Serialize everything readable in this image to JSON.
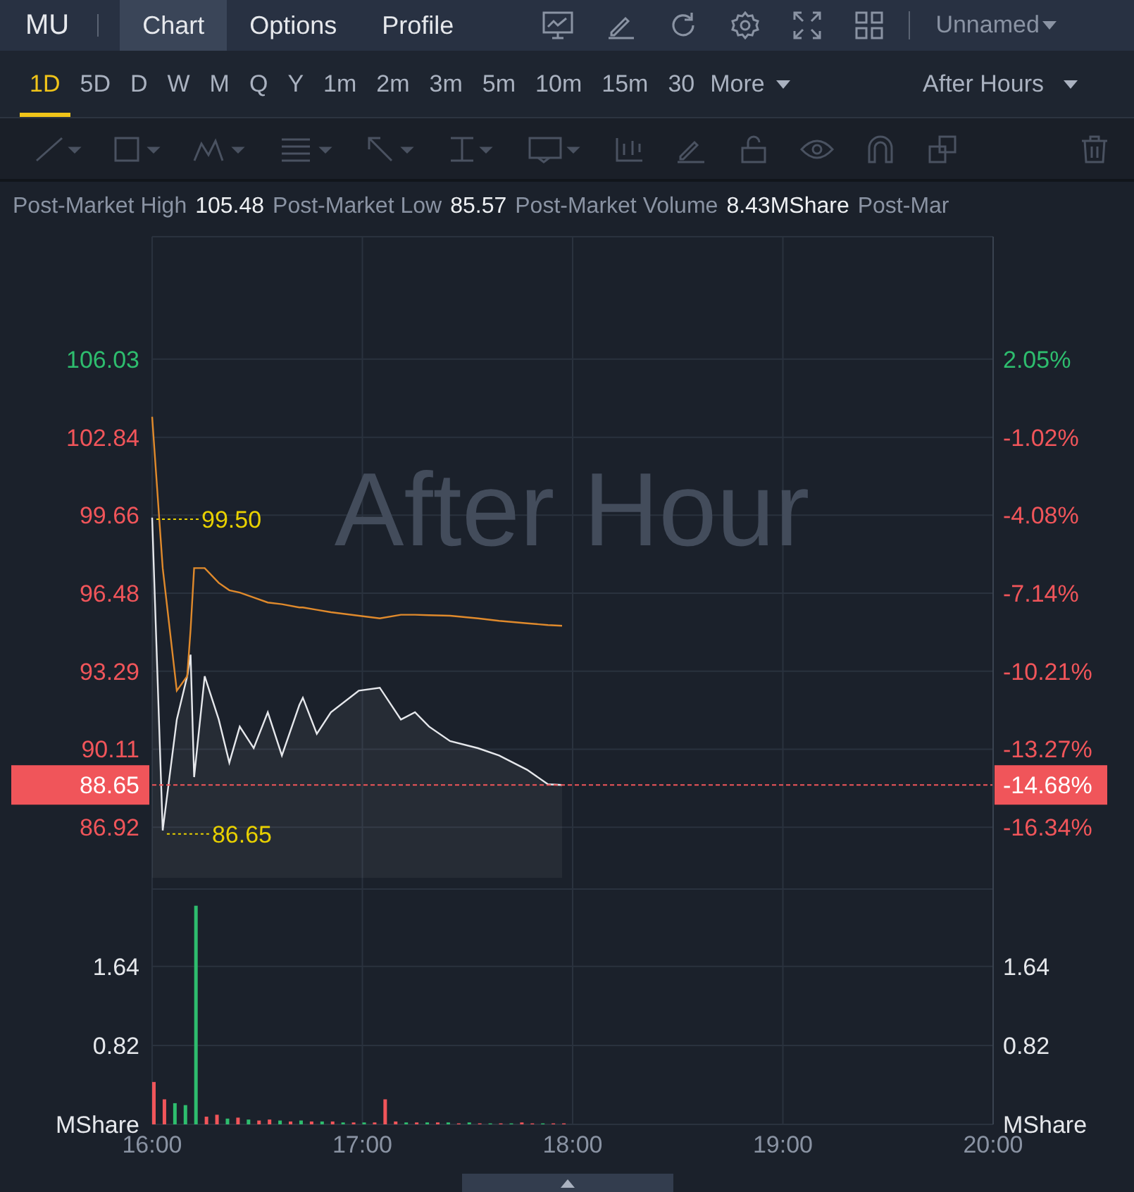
{
  "header": {
    "symbol": "MU",
    "tabs": [
      {
        "label": "Chart",
        "selected": true
      },
      {
        "label": "Options",
        "selected": false
      },
      {
        "label": "Profile",
        "selected": false
      }
    ],
    "layout_menu": "Unnamed"
  },
  "periods": [
    {
      "label": "1D",
      "selected": true
    },
    {
      "label": "5D",
      "selected": false
    },
    {
      "label": "D",
      "selected": false
    },
    {
      "label": "W",
      "selected": false
    },
    {
      "label": "M",
      "selected": false
    },
    {
      "label": "Q",
      "selected": false
    },
    {
      "label": "Y",
      "selected": false
    },
    {
      "label": "1m",
      "selected": false
    },
    {
      "label": "2m",
      "selected": false
    },
    {
      "label": "3m",
      "selected": false
    },
    {
      "label": "5m",
      "selected": false
    },
    {
      "label": "10m",
      "selected": false
    },
    {
      "label": "15m",
      "selected": false
    },
    {
      "label": "30",
      "selected": false
    }
  ],
  "more_menu": "More",
  "session_menu": "After Hours",
  "stats": [
    {
      "label": "Post-Market High",
      "value": "105.48"
    },
    {
      "label": "Post-Market Low",
      "value": "85.57"
    },
    {
      "label": "Post-Market Volume",
      "value": "8.43MShare"
    },
    {
      "label": "Post-Mar"
    }
  ],
  "price_chart": {
    "watermark": "After Hour",
    "current_change": "-14.68%",
    "right_labels": [
      {
        "text": "2.05%",
        "color": "#2ebd6e"
      },
      {
        "text": "-1.02%",
        "color": "#f0555a"
      },
      {
        "text": "-4.08%",
        "color": "#f0555a"
      },
      {
        "text": "-7.14%",
        "color": "#f0555a"
      },
      {
        "text": "-10.21%",
        "color": "#f0555a"
      },
      {
        "text": "-13.27%",
        "color": "#f0555a"
      },
      {
        "text": "-16.34%",
        "color": "#f0555a"
      }
    ],
    "chart_data": {
      "type": "line",
      "x": [
        16,
        16.05,
        16.117,
        16.167,
        16.183,
        16.2,
        16.25,
        16.317,
        16.367,
        16.417,
        16.483,
        16.55,
        16.617,
        16.7,
        16.717,
        16.783,
        16.85,
        16.983,
        17.083,
        17.183,
        17.25,
        17.317,
        17.417,
        17.55,
        17.65,
        17.783,
        17.883,
        17.95
      ],
      "xlim": [
        16,
        20
      ],
      "ylim": [
        84.86,
        111.03
      ],
      "yticks": [
        106.03,
        102.84,
        99.66,
        96.48,
        93.29,
        90.11,
        86.92
      ],
      "series": [
        {
          "color": "#e6e8ec",
          "values": [
            99.56,
            86.79,
            91.32,
            93.09,
            93.97,
            88.97,
            93.09,
            91.32,
            89.56,
            91.03,
            90.15,
            91.62,
            89.85,
            91.91,
            92.21,
            90.74,
            91.62,
            92.5,
            92.62,
            91.32,
            91.62,
            91.03,
            90.44,
            90.15,
            89.85,
            89.27,
            88.68,
            88.65
          ]
        },
        {
          "color": "#e08a2c",
          "values": [
            103.68,
            97.5,
            92.5,
            93.09,
            95.0,
            97.5,
            97.5,
            96.9,
            96.6,
            96.5,
            96.3,
            96.1,
            96.03,
            95.9,
            95.9,
            95.8,
            95.7,
            95.56,
            95.45,
            95.6,
            95.6,
            95.58,
            95.56,
            95.45,
            95.35,
            95.25,
            95.18,
            95.15
          ]
        }
      ],
      "grid": true,
      "ref_lines": [
        {
          "axis": "y",
          "value": 88.65,
          "label": "88.65",
          "color": "#f0555a"
        }
      ],
      "annotations": [
        {
          "x": 16,
          "y": 99.5,
          "text": "99.50"
        },
        {
          "x": 16.05,
          "y": 86.65,
          "text": "86.65"
        }
      ]
    }
  },
  "volume_chart": {
    "right_labels": [
      "1.64",
      "0.82",
      "MShare"
    ],
    "chart_data": {
      "type": "bar",
      "x": [
        16,
        16.05,
        16.1,
        16.15,
        16.2,
        16.25,
        16.3,
        16.35,
        16.4,
        16.45,
        16.5,
        16.55,
        16.6,
        16.65,
        16.7,
        16.75,
        16.8,
        16.85,
        16.9,
        16.95,
        17,
        17.05,
        17.1,
        17.15,
        17.2,
        17.25,
        17.3,
        17.35,
        17.4,
        17.45,
        17.5,
        17.55,
        17.6,
        17.65,
        17.7,
        17.75,
        17.8,
        17.85,
        17.9,
        17.95
      ],
      "xlim": [
        16,
        20
      ],
      "ylim": [
        0,
        2.56
      ],
      "stacked": true,
      "grid": true,
      "yticks": [
        {
          "value": 0,
          "label": "MShare"
        },
        0.82,
        1.64
      ],
      "xticks": [
        {
          "value": 16,
          "label": "16:00"
        },
        {
          "value": 17,
          "label": "17:00"
        },
        {
          "value": 18,
          "label": "18:00"
        },
        {
          "value": 19,
          "label": "19:00"
        },
        {
          "value": 20,
          "label": "20:00"
        }
      ],
      "series": [
        {
          "color": "#2ebd6e",
          "values": [
            null,
            null,
            0.22,
            0.2,
            2.27,
            null,
            null,
            0.06,
            null,
            0.05,
            null,
            null,
            0.04,
            null,
            0.04,
            null,
            0.03,
            null,
            0.02,
            null,
            0.02,
            null,
            null,
            null,
            0.02,
            null,
            0.02,
            null,
            0.02,
            null,
            0.02,
            null,
            0.01,
            null,
            0.01,
            null,
            null,
            0.01,
            null,
            null
          ]
        },
        {
          "color": "#f0555a",
          "values": [
            0.44,
            0.26,
            null,
            null,
            null,
            0.08,
            0.1,
            null,
            0.07,
            null,
            0.04,
            0.05,
            null,
            0.03,
            null,
            0.03,
            null,
            0.03,
            null,
            0.02,
            null,
            0.02,
            0.26,
            0.03,
            null,
            0.02,
            null,
            0.02,
            null,
            0.01,
            null,
            0.01,
            null,
            0.01,
            null,
            0.02,
            0.01,
            null,
            0.01,
            0.01
          ]
        }
      ]
    }
  }
}
